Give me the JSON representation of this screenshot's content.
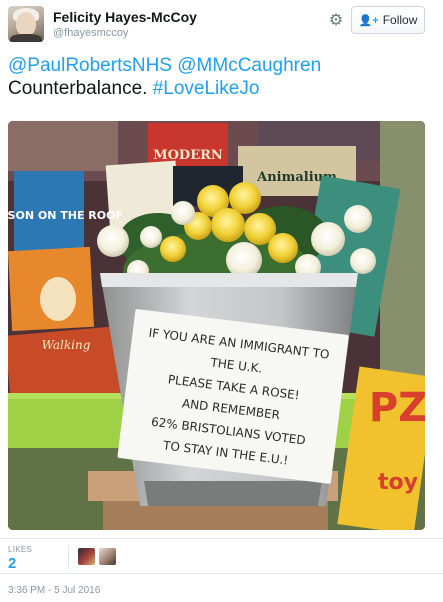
{
  "header": {
    "display_name": "Felicity Hayes-McCoy",
    "handle": "@fhayesmccoy",
    "follow_label": "Follow"
  },
  "tweet": {
    "mention1": "@PaulRobertsNHS",
    "mention2": "@MMcCaughren",
    "body": "Counterbalance.",
    "hashtag": "#LoveLikeJo"
  },
  "photo": {
    "sign_lines": [
      "IF YOU ARE AN IMMIGRANT TO",
      "THE U.K.",
      "PLEASE TAKE A ROSE!",
      "AND REMEMBER",
      "62% BRISTOLIANS VOTED",
      "TO STAY IN THE E.U.!"
    ],
    "book_titles": [
      "KARLSON ON THE ROOF",
      "Animalium",
      "MODERN",
      "Walking",
      "toy"
    ]
  },
  "likes": {
    "label": "LIKES",
    "count": "2"
  },
  "timestamp": "3:36 PM - 5 Jul 2016",
  "colors": {
    "accent": "#1da1f2",
    "text": "#14171a",
    "muted": "#8899a6"
  }
}
